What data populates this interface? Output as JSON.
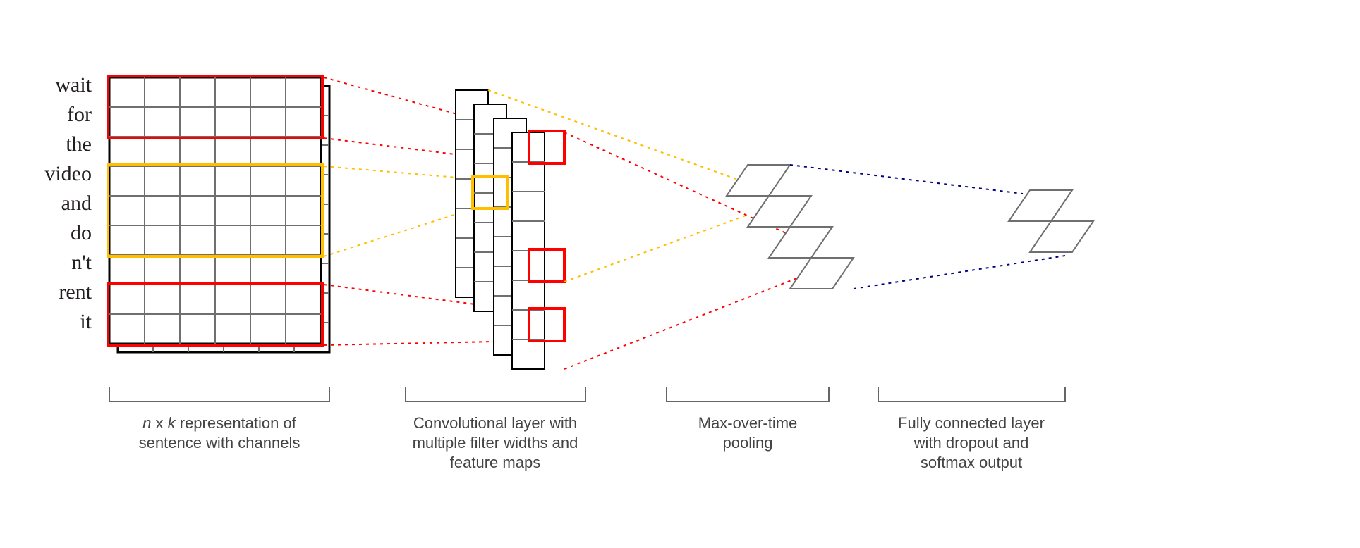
{
  "words": [
    "wait",
    "for",
    "the",
    "video",
    "and",
    "do",
    "n't",
    "rent",
    "it"
  ],
  "captions": {
    "c1a": "n x k representation of",
    "c1b": "sentence with  channels",
    "c2a": "Convolutional layer with",
    "c2b": "multiple filter widths and",
    "c2c": "feature maps",
    "c3a": "Max-over-time",
    "c3b": "pooling",
    "c4a": "Fully connected layer",
    "c4b": "with dropout and",
    "c4c": "softmax output"
  },
  "diagram_notes": "CNN architecture for sentence classification: word embedding matrix (n x k, two channels) -> convolutional filters of multiple widths producing feature maps -> max-over-time pooling -> fully connected softmax output.",
  "colors": {
    "red": "#ff0000",
    "yellow": "#ffbf00",
    "blue": "#000080",
    "grid": "#6f6f6f"
  }
}
